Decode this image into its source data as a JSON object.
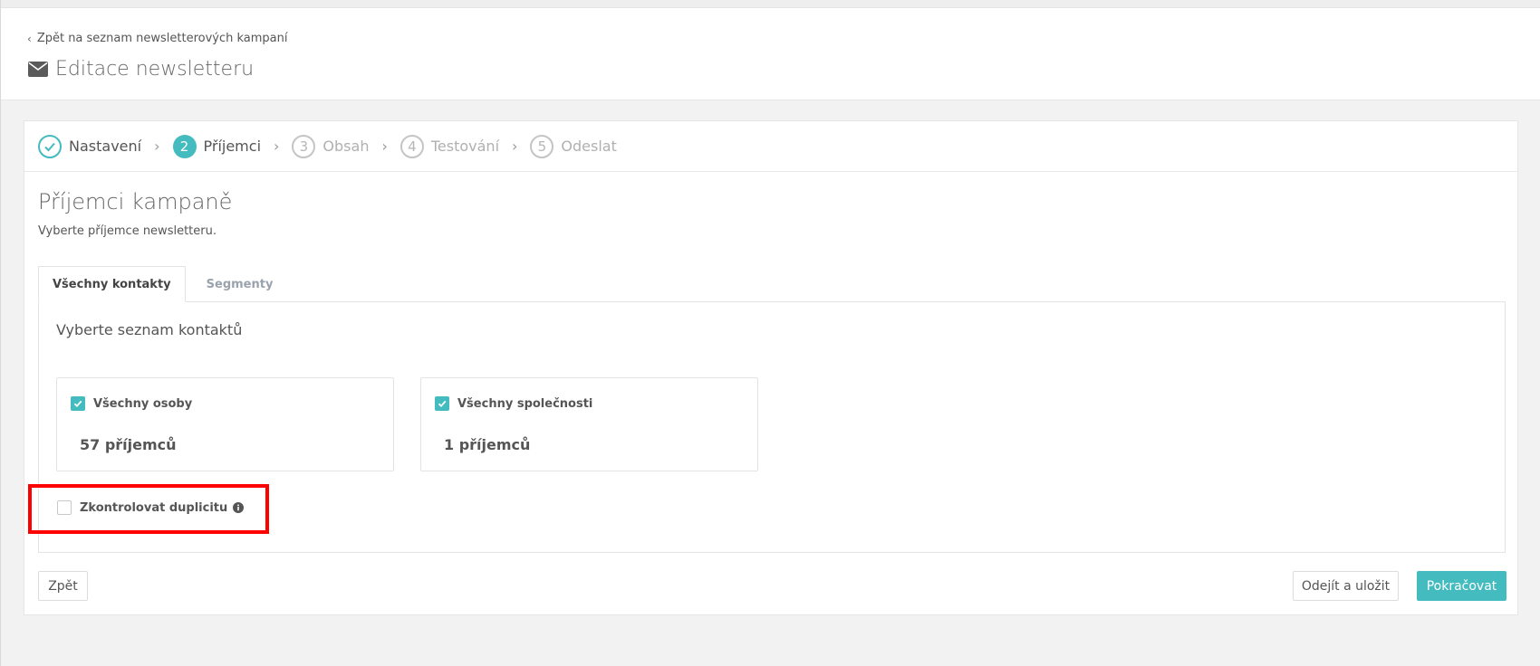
{
  "header": {
    "back_link": "Zpět na seznam newsletterových kampaní",
    "title": "Editace newsletteru"
  },
  "steps": [
    {
      "number": "",
      "label": "Nastavení",
      "state": "done"
    },
    {
      "number": "2",
      "label": "Příjemci",
      "state": "active"
    },
    {
      "number": "3",
      "label": "Obsah",
      "state": "todo"
    },
    {
      "number": "4",
      "label": "Testování",
      "state": "todo"
    },
    {
      "number": "5",
      "label": "Odeslat",
      "state": "todo"
    }
  ],
  "section": {
    "title": "Příjemci kampaně",
    "subtitle": "Vyberte příjemce newsletteru."
  },
  "tabs": [
    {
      "label": "Všechny kontakty",
      "active": true
    },
    {
      "label": "Segmenty",
      "active": false
    }
  ],
  "panel": {
    "heading": "Vyberte seznam kontaktů",
    "lists": [
      {
        "label": "Všechny osoby",
        "count": "57 příjemců",
        "checked": true
      },
      {
        "label": "Všechny společnosti",
        "count": "1 příjemců",
        "checked": true
      }
    ],
    "duplicate_check": {
      "label": "Zkontrolovat duplicitu",
      "checked": false
    }
  },
  "buttons": {
    "back": "Zpět",
    "save_exit": "Odejít a uložit",
    "continue": "Pokračovat"
  },
  "colors": {
    "accent": "#44bbbf",
    "highlight": "#ff0000"
  },
  "icons": {
    "title": "envelope-icon",
    "back": "chevron-left-icon",
    "step_done": "check-circle-icon",
    "step_sep": "chevron-right-icon",
    "checkbox_checked": "checkmark-icon",
    "info": "info-circle-icon"
  }
}
